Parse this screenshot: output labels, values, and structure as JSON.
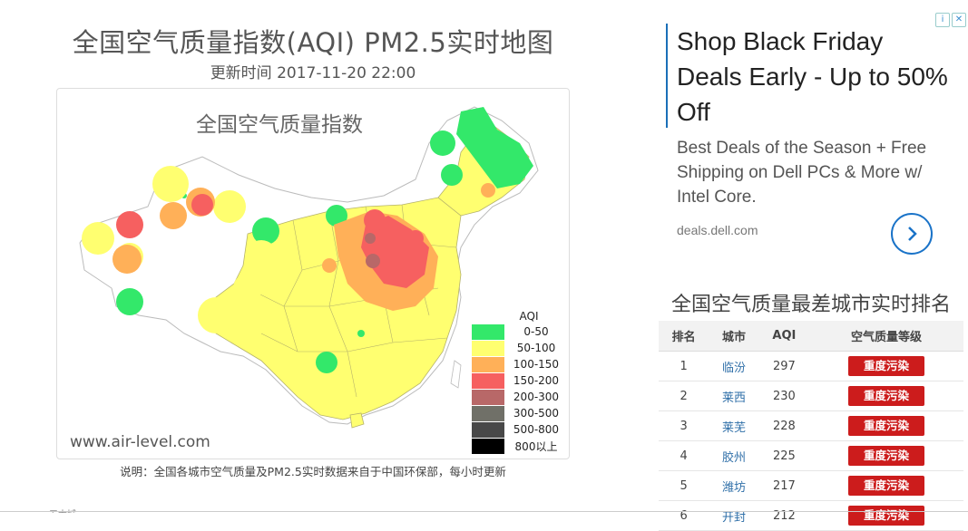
{
  "page": {
    "title": "全国空气质量指数(AQI) PM2.5实时地图",
    "update_time": "更新时间 2017-11-20 22:00",
    "map_title": "全国空气质量指数",
    "site": "www.air-level.com",
    "note": "说明：全国各城市空气质量及PM2.5实时数据来自于中国环保部，每小时更新",
    "cut_text": "五大城"
  },
  "legend": {
    "title": "AQI",
    "items": [
      {
        "label": "0-50",
        "color": "#33e86a"
      },
      {
        "label": "50-100",
        "color": "#ffff70"
      },
      {
        "label": "100-150",
        "color": "#ffb058"
      },
      {
        "label": "150-200",
        "color": "#f66060"
      },
      {
        "label": "200-300",
        "color": "#b86868"
      },
      {
        "label": "300-500",
        "color": "#707068"
      },
      {
        "label": "500-800",
        "color": "#484848"
      },
      {
        "label": "800以上",
        "color": "#000000"
      }
    ]
  },
  "ad": {
    "headline": "Shop Black Friday Deals Early - Up to 50% Off",
    "body": "Best Deals of the Season + Free Shipping on Dell PCs & More w/ Intel Core.",
    "url": "deals.dell.com",
    "info_icon": "info-icon",
    "close_icon": "close-icon",
    "button_icon": "chevron-right-icon"
  },
  "ranking": {
    "title": "全国空气质量最差城市实时排名",
    "headers": [
      "排名",
      "城市",
      "AQI",
      "空气质量等级"
    ],
    "rows": [
      {
        "rank": "1",
        "city": "临汾",
        "aqi": "297",
        "level": "重度污染"
      },
      {
        "rank": "2",
        "city": "莱西",
        "aqi": "230",
        "level": "重度污染"
      },
      {
        "rank": "3",
        "city": "莱芜",
        "aqi": "228",
        "level": "重度污染"
      },
      {
        "rank": "4",
        "city": "胶州",
        "aqi": "225",
        "level": "重度污染"
      },
      {
        "rank": "5",
        "city": "潍坊",
        "aqi": "217",
        "level": "重度污染"
      },
      {
        "rank": "6",
        "city": "开封",
        "aqi": "212",
        "level": "重度污染"
      }
    ],
    "badge_color": "#cc1c1c"
  }
}
